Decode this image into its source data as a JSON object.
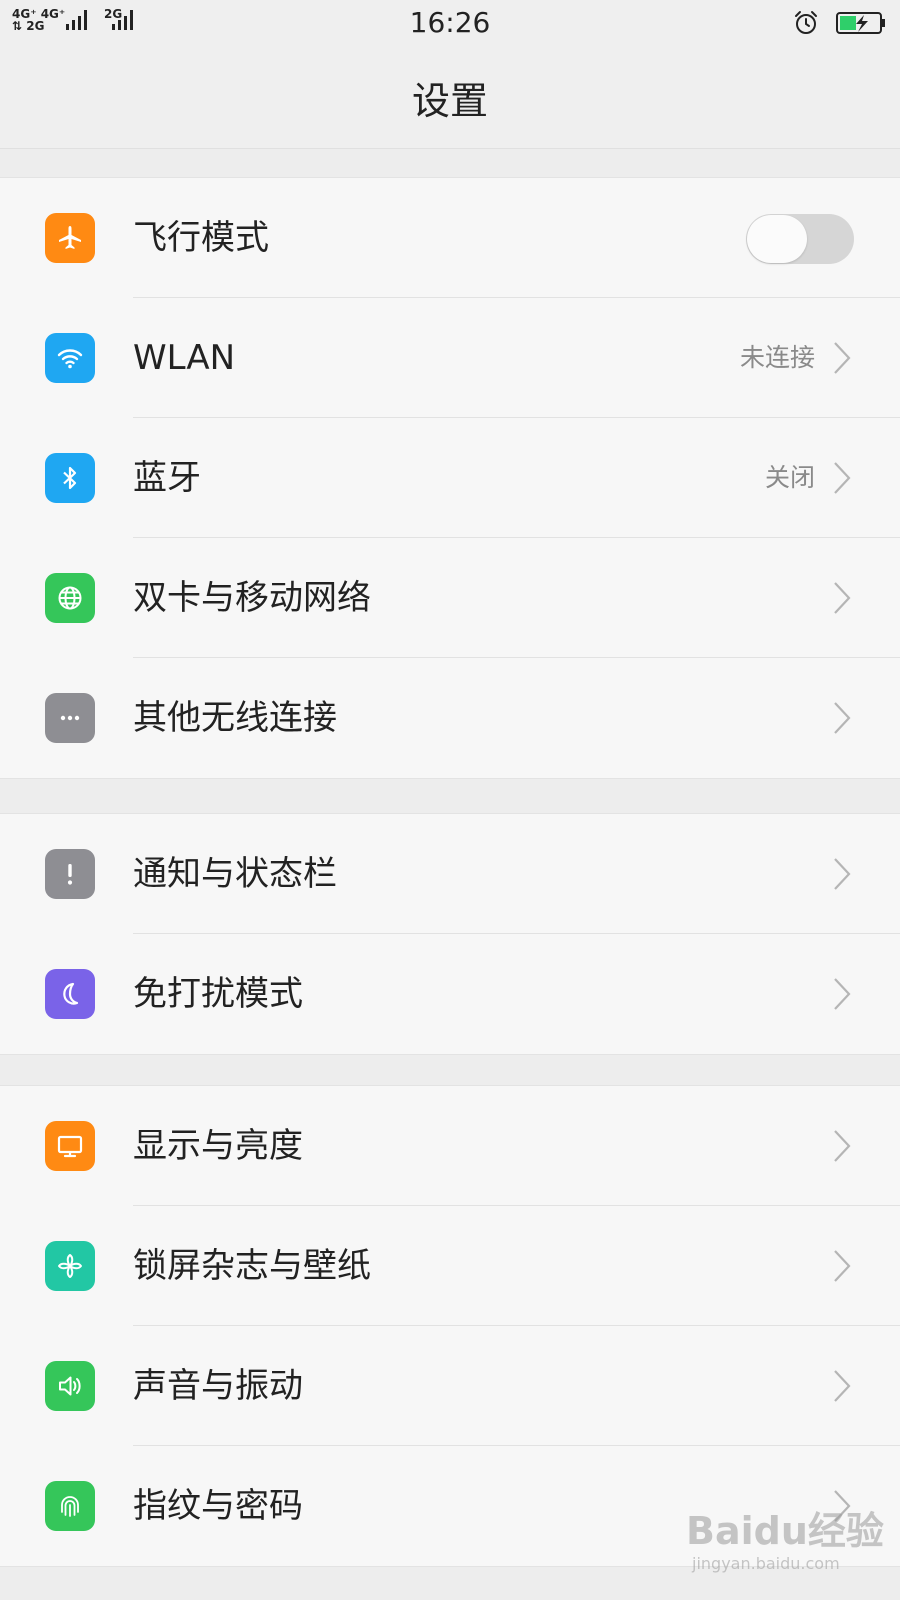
{
  "status_bar": {
    "sim1_top": "4G⁺ 4G⁺",
    "sim1_bottom": "⇅ 2G",
    "sim2": "2G",
    "time": "16:26",
    "alarm_icon": "alarm-clock-icon",
    "battery_icon": "battery-charging-icon",
    "battery_color": "#2fcf6a"
  },
  "header": {
    "title": "设置"
  },
  "groups": [
    {
      "items": [
        {
          "label": "飞行模式",
          "icon": "airplane-icon",
          "icon_color": "#ff8a13",
          "toggle": false
        },
        {
          "label": "WLAN",
          "icon": "wifi-icon",
          "icon_color": "#1fa7f2",
          "value": "未连接"
        },
        {
          "label": "蓝牙",
          "icon": "bluetooth-icon",
          "icon_color": "#1fa7f2",
          "value": "关闭"
        },
        {
          "label": "双卡与移动网络",
          "icon": "globe-icon",
          "icon_color": "#35c65a"
        },
        {
          "label": "其他无线连接",
          "icon": "more-dots-icon",
          "icon_color": "#8e8e93"
        }
      ]
    },
    {
      "items": [
        {
          "label": "通知与状态栏",
          "icon": "exclamation-icon",
          "icon_color": "#8e8e93"
        },
        {
          "label": "免打扰模式",
          "icon": "moon-icon",
          "icon_color": "#7a63e8"
        }
      ]
    },
    {
      "items": [
        {
          "label": "显示与亮度",
          "icon": "monitor-icon",
          "icon_color": "#ff8a13"
        },
        {
          "label": "锁屏杂志与壁纸",
          "icon": "pinwheel-icon",
          "icon_color": "#22c7a4"
        },
        {
          "label": "声音与振动",
          "icon": "speaker-icon",
          "icon_color": "#35c65a"
        },
        {
          "label": "指纹与密码",
          "icon": "fingerprint-icon",
          "icon_color": "#35c65a"
        }
      ]
    }
  ],
  "watermark": {
    "logo": "Baidu经验",
    "url": "jingyan.baidu.com"
  }
}
